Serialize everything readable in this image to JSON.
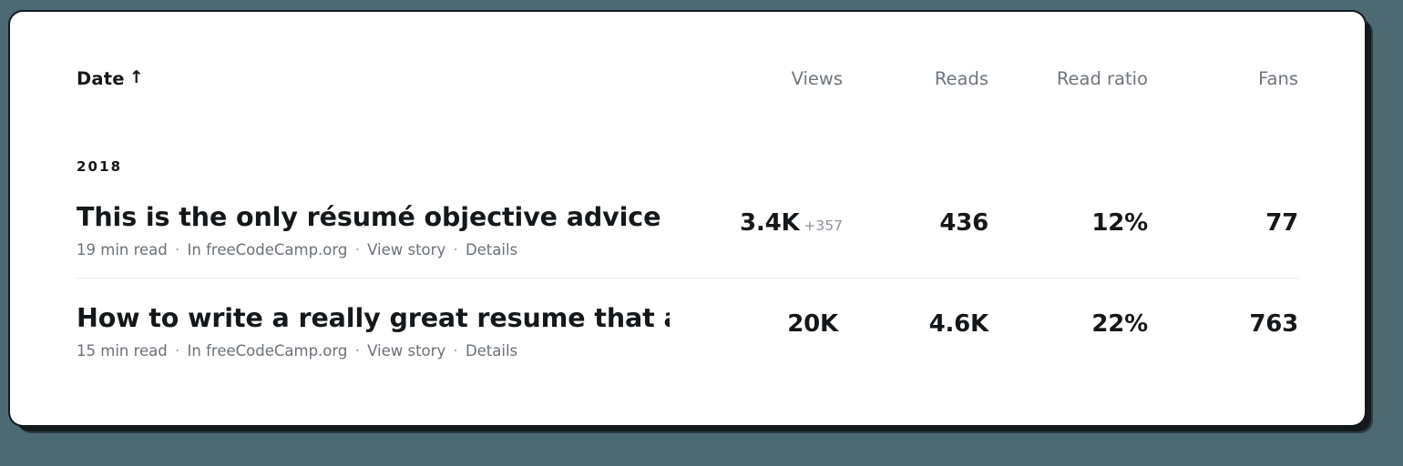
{
  "table": {
    "header": {
      "date_label": "Date",
      "sort_icon": "sort-ascending-arrow",
      "sort_glyph": "↑",
      "views_label": "Views",
      "reads_label": "Reads",
      "read_ratio_label": "Read ratio",
      "fans_label": "Fans"
    },
    "groups": [
      {
        "year": "2018",
        "stories": [
          {
            "title": "This is the only résumé objective advice you need t…",
            "read_time": "19 min read",
            "publication": "In freeCodeCamp.org",
            "view_story_label": "View story",
            "details_label": "Details",
            "separator": "·",
            "views": "3.4K",
            "views_delta": "+357",
            "reads": "436",
            "read_ratio": "12%",
            "fans": "77"
          },
          {
            "title": "How to write a really great resume that actually get…",
            "read_time": "15 min read",
            "publication": "In freeCodeCamp.org",
            "view_story_label": "View story",
            "details_label": "Details",
            "separator": "·",
            "views": "20K",
            "views_delta": "",
            "reads": "4.6K",
            "read_ratio": "22%",
            "fans": "763"
          }
        ]
      }
    ]
  },
  "colors": {
    "page_background": "#4d6a73",
    "card_background": "#ffffff",
    "card_border": "#14191c",
    "primary_text": "#15181a",
    "muted_text": "#6b7177",
    "header_metric_text": "#6f767c",
    "divider": "#ececec",
    "delta_text": "#8d9399"
  }
}
